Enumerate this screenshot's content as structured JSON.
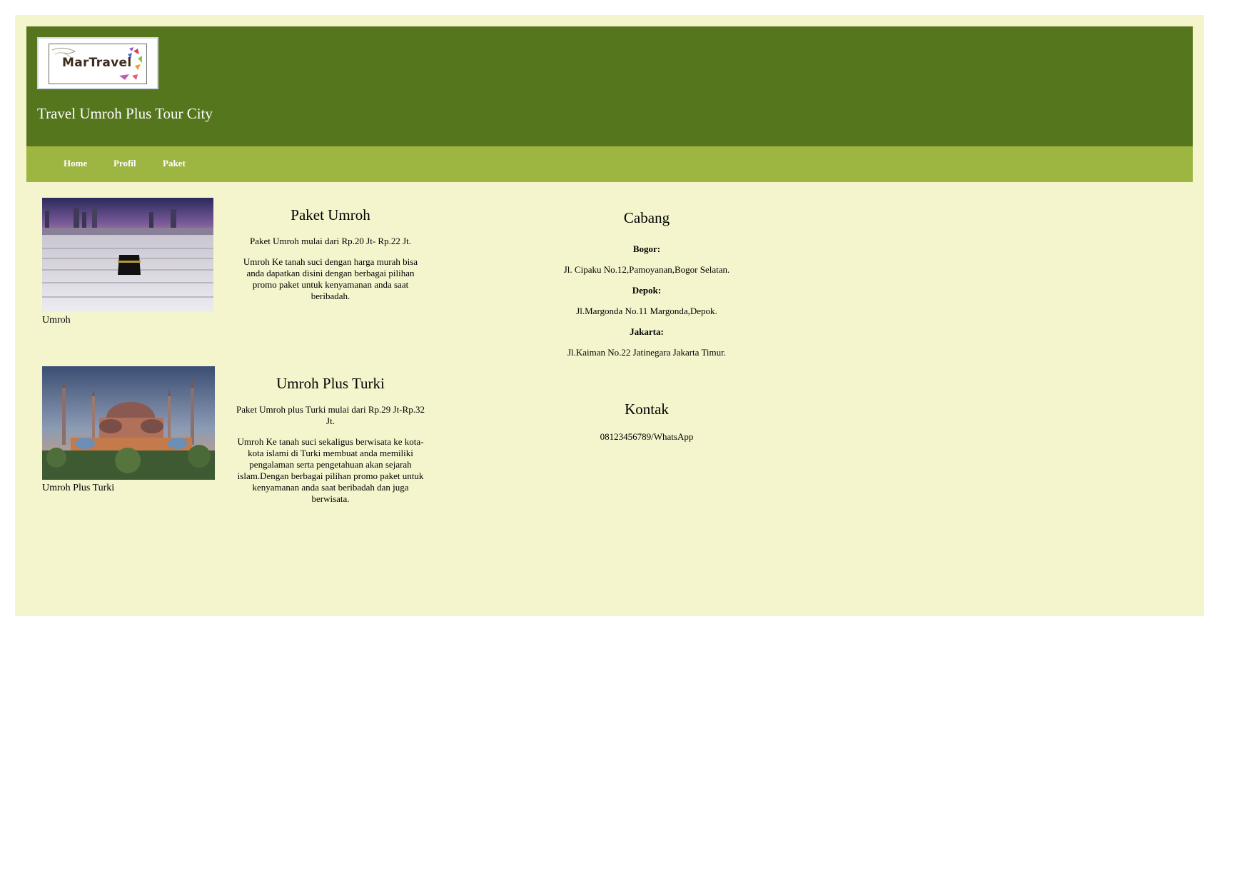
{
  "header": {
    "logo_text": "MarTravel",
    "site_title": "Travel Umroh Plus Tour City"
  },
  "nav": {
    "items": [
      {
        "label": "Home"
      },
      {
        "label": "Profil"
      },
      {
        "label": "Paket"
      }
    ]
  },
  "packages": [
    {
      "caption": "Umroh",
      "title": "Paket Umroh",
      "price": "Paket Umroh mulai dari Rp.20 Jt- Rp.22 Jt.",
      "description": "Umroh Ke tanah suci dengan harga murah bisa anda dapatkan disini dengan berbagai pilihan promo paket untuk kenyamanan anda saat beribadah."
    },
    {
      "caption": "Umroh Plus Turki",
      "title": "Umroh Plus Turki",
      "price": "Paket Umroh plus Turki mulai dari Rp.29 Jt-Rp.32 Jt.",
      "description": "Umroh Ke tanah suci sekaligus berwisata ke kota-kota islami di Turki membuat anda memiliki pengalaman serta pengetahuan akan sejarah islam.Dengan berbagai pilihan promo paket untuk kenyamanan anda saat beribadah dan juga berwisata."
    }
  ],
  "branches": {
    "title": "Cabang",
    "items": [
      {
        "city": "Bogor:",
        "address": "Jl. Cipaku No.12,Pamoyanan,Bogor Selatan."
      },
      {
        "city": "Depok:",
        "address": "Jl.Margonda No.11 Margonda,Depok."
      },
      {
        "city": "Jakarta:",
        "address": "Jl.Kaiman No.22 Jatinegara Jakarta Timur."
      }
    ]
  },
  "contact": {
    "title": "Kontak",
    "phone": "08123456789/WhatsApp"
  },
  "colors": {
    "page_bg": "#f4f5cd",
    "header_bg": "#56761d",
    "nav_bg": "#9db541"
  }
}
